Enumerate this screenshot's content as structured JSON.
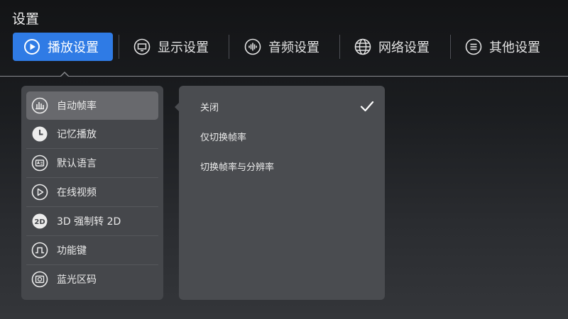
{
  "page": {
    "title": "设置"
  },
  "tabs": [
    {
      "label": "播放设置",
      "icon": "play-circle-icon",
      "active": true
    },
    {
      "label": "显示设置",
      "icon": "display-icon",
      "active": false
    },
    {
      "label": "音频设置",
      "icon": "audio-wave-icon",
      "active": false
    },
    {
      "label": "网络设置",
      "icon": "globe-icon",
      "active": false
    },
    {
      "label": "其他设置",
      "icon": "list-circle-icon",
      "active": false
    }
  ],
  "menu": {
    "items": [
      {
        "label": "自动帧率",
        "icon": "bar-chart-icon",
        "selected": true
      },
      {
        "label": "记忆播放",
        "icon": "clock-icon",
        "selected": false
      },
      {
        "label": "默认语言",
        "icon": "language-icon",
        "selected": false
      },
      {
        "label": "在线视频",
        "icon": "play-circle-icon",
        "selected": false
      },
      {
        "label": "3D 强制转 2D",
        "icon": "2d-icon",
        "selected": false
      },
      {
        "label": "功能键",
        "icon": "function-key-icon",
        "selected": false
      },
      {
        "label": "蓝光区码",
        "icon": "disc-icon",
        "selected": false
      }
    ]
  },
  "options": {
    "items": [
      {
        "label": "关闭",
        "checked": true
      },
      {
        "label": "仅切换帧率",
        "checked": false
      },
      {
        "label": "切换帧率与分辨率",
        "checked": false
      }
    ]
  },
  "colors": {
    "accent": "#2f7be5",
    "panel": "#45474b",
    "options_panel": "#4a4c50",
    "selected_item": "#68696d"
  }
}
